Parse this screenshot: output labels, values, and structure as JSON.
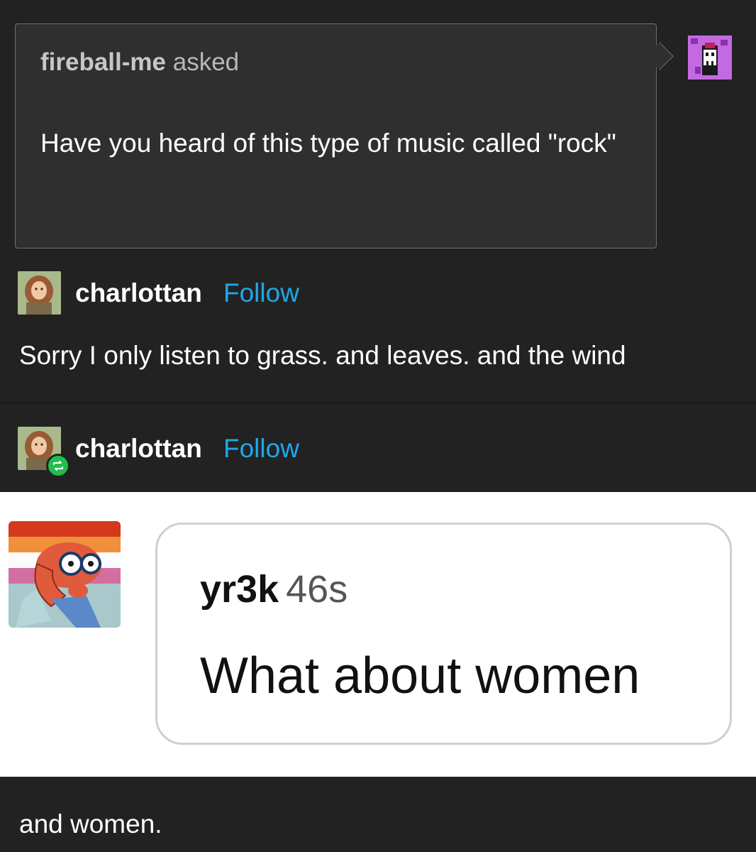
{
  "ask": {
    "asker": "fireball-me",
    "verb": "asked",
    "question": "Have you heard of this type of music called \"rock\""
  },
  "answer": {
    "username": "charlottan",
    "follow_label": "Follow",
    "text": "Sorry I only listen to grass. and leaves. and the wind"
  },
  "reblog": {
    "username": "charlottan",
    "follow_label": "Follow",
    "embedded": {
      "name": "yr3k",
      "time": "46s",
      "text": "What about women"
    },
    "text": "and women."
  },
  "colors": {
    "background": "#222222",
    "follow": "#1fa7ea",
    "reblog_badge": "#1fbf4d"
  },
  "icons": {
    "asker_avatar": "pixel-ghost-avatar-icon",
    "user_avatar": "illustrated-girl-avatar-icon",
    "reblog": "reblog-icon",
    "embedded_avatar": "cartoon-character-avatar-icon"
  }
}
